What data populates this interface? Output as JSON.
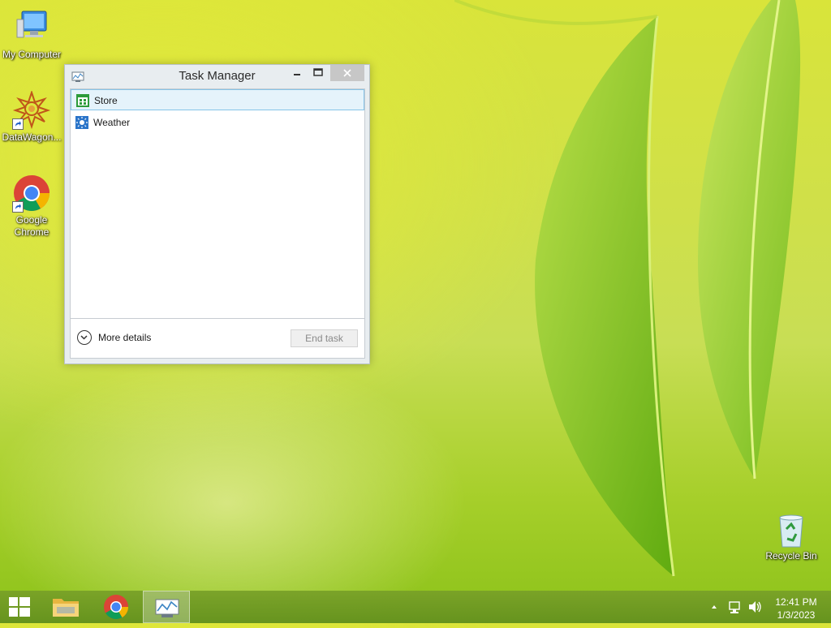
{
  "desktop": {
    "icons": [
      {
        "label": "My Computer"
      },
      {
        "label": "DataWagon..."
      },
      {
        "label": "Google Chrome"
      },
      {
        "label": "Recycle Bin"
      }
    ]
  },
  "task_manager": {
    "title": "Task Manager",
    "apps": [
      {
        "name": "Store",
        "icon": "store-icon"
      },
      {
        "name": "Weather",
        "icon": "weather-icon"
      }
    ],
    "more_details": "More details",
    "end_task": "End task"
  },
  "taskbar": {
    "time": "12:41 PM",
    "date": "1/3/2023"
  },
  "colors": {
    "selection_bg": "#e5f3fb",
    "selection_border": "#86c4e8",
    "close_button": "#c7c7c7"
  }
}
